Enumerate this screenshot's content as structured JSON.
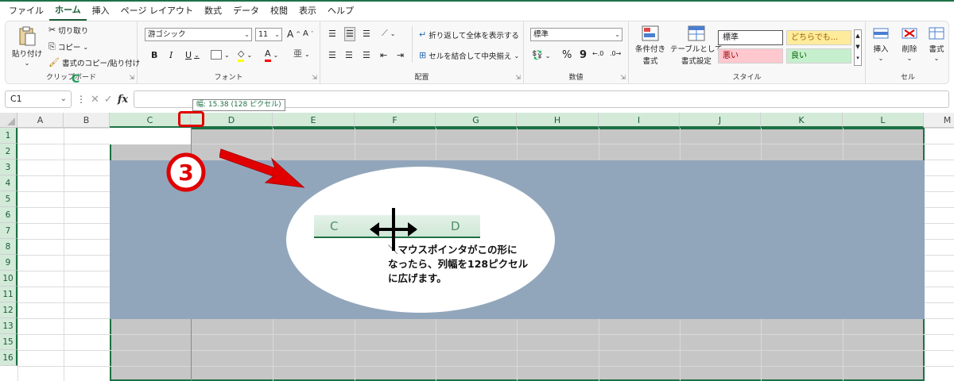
{
  "menu": {
    "items": [
      "ファイル",
      "ホーム",
      "挿入",
      "ページ レイアウト",
      "数式",
      "データ",
      "校閲",
      "表示",
      "ヘルプ"
    ],
    "active_index": 1
  },
  "ribbon": {
    "clipboard": {
      "label": "クリップボード",
      "paste": "貼り付け",
      "cut": "切り取り",
      "copy": "コピー",
      "format_painter": "書式のコピー/貼り付け"
    },
    "font": {
      "label": "フォント",
      "font_name": "游ゴシック",
      "font_size": "11",
      "bold": "B",
      "italic": "I",
      "underline": "U",
      "grow": "A",
      "shrink": "A"
    },
    "alignment": {
      "label": "配置",
      "wrap_text": "折り返して全体を表示する",
      "merge_center": "セルを結合して中央揃え"
    },
    "number": {
      "label": "数値",
      "format": "標準",
      "percent": "%",
      "comma": "9"
    },
    "styles": {
      "label": "スタイル",
      "conditional": [
        "条件付き",
        "書式"
      ],
      "as_table": [
        "テーブルとして",
        "書式設定"
      ],
      "cells": [
        {
          "text": "標準",
          "bg": "#ffffff",
          "color": "#222222"
        },
        {
          "text": "どちらでも...",
          "bg": "#ffeb9c",
          "color": "#9c6500"
        },
        {
          "text": "悪い",
          "bg": "#ffc7ce",
          "color": "#9c0006"
        },
        {
          "text": "良い",
          "bg": "#c6efce",
          "color": "#006100"
        }
      ]
    },
    "cells_group": {
      "label": "セル",
      "insert": "挿入",
      "delete": "削除",
      "format": "書式"
    }
  },
  "formula_bar": {
    "name_box": "C1",
    "fx": "fx",
    "value": ""
  },
  "tooltip": "幅: 15.38 (128 ピクセル)",
  "grid": {
    "columns": [
      "A",
      "B",
      "C",
      "D",
      "E",
      "F",
      "G",
      "H",
      "I",
      "J",
      "K",
      "L",
      "M"
    ],
    "rows": [
      "1",
      "2",
      "3",
      "4",
      "5",
      "6",
      "7",
      "8",
      "9",
      "10",
      "11",
      "12",
      "13",
      "15",
      "16"
    ],
    "selected_columns": [
      "C",
      "D",
      "E",
      "F",
      "G",
      "H",
      "I",
      "J",
      "K",
      "L"
    ]
  },
  "annotation": {
    "step": "3",
    "zoom_left": "C",
    "zoom_right": "D",
    "note_line1": "マウスポインタがこの形に",
    "note_line2": "なったら、列幅を128ピクセル",
    "note_line3": "に広げます。",
    "tick": "＼"
  },
  "colors": {
    "accent": "#1e7145",
    "overlay": "#92a6bb",
    "marker": "#e00000"
  }
}
